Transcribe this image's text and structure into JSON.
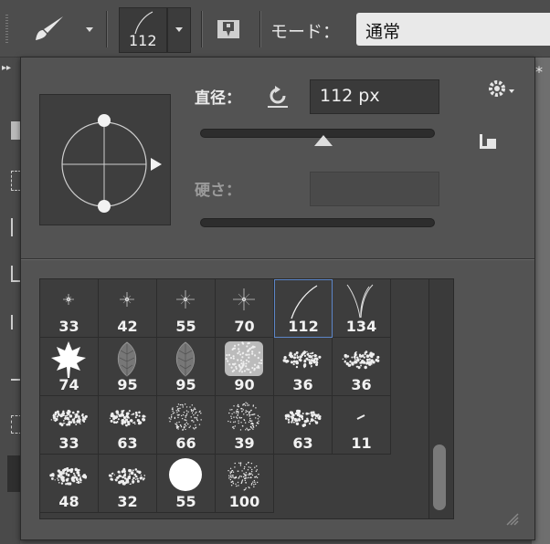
{
  "optionbar": {
    "preset_size": "112",
    "mode_label": "モード：",
    "mode_value": "通常"
  },
  "popup": {
    "size_label": "直径：",
    "size_value": "112 px",
    "size_slider_fraction": 0.53,
    "hardness_label": "硬さ：",
    "hardness_value": ""
  },
  "brushes": [
    {
      "size": "33",
      "icon": "star-brush-icon"
    },
    {
      "size": "42",
      "icon": "star-brush-icon"
    },
    {
      "size": "55",
      "icon": "star-brush-icon"
    },
    {
      "size": "70",
      "icon": "star-brush-icon"
    },
    {
      "size": "112",
      "icon": "grass-stroke-brush-icon",
      "selected": true
    },
    {
      "size": "134",
      "icon": "grass-stroke-brush-icon"
    },
    {
      "size": "74",
      "icon": "maple-leaf-brush-icon"
    },
    {
      "size": "95",
      "icon": "leaf-brush-icon"
    },
    {
      "size": "95",
      "icon": "leaf-brush-icon"
    },
    {
      "size": "90",
      "icon": "texture-brush-icon"
    },
    {
      "size": "36",
      "icon": "splatter-brush-icon"
    },
    {
      "size": "36",
      "icon": "splatter-brush-icon"
    },
    {
      "size": "33",
      "icon": "splatter-brush-icon"
    },
    {
      "size": "63",
      "icon": "splatter-brush-icon"
    },
    {
      "size": "66",
      "icon": "spray-brush-icon"
    },
    {
      "size": "39",
      "icon": "spray-brush-icon"
    },
    {
      "size": "63",
      "icon": "splatter-brush-icon"
    },
    {
      "size": "11",
      "icon": "dash-brush-icon"
    },
    {
      "size": "48",
      "icon": "splatter-brush-icon"
    },
    {
      "size": "32",
      "icon": "splatter-brush-icon"
    },
    {
      "size": "55",
      "icon": "round-hard-brush-icon"
    },
    {
      "size": "100",
      "icon": "spray-brush-icon"
    }
  ],
  "colors": {
    "accent": "#5c86c8",
    "panel": "#535353",
    "field": "#3a3a3a"
  }
}
